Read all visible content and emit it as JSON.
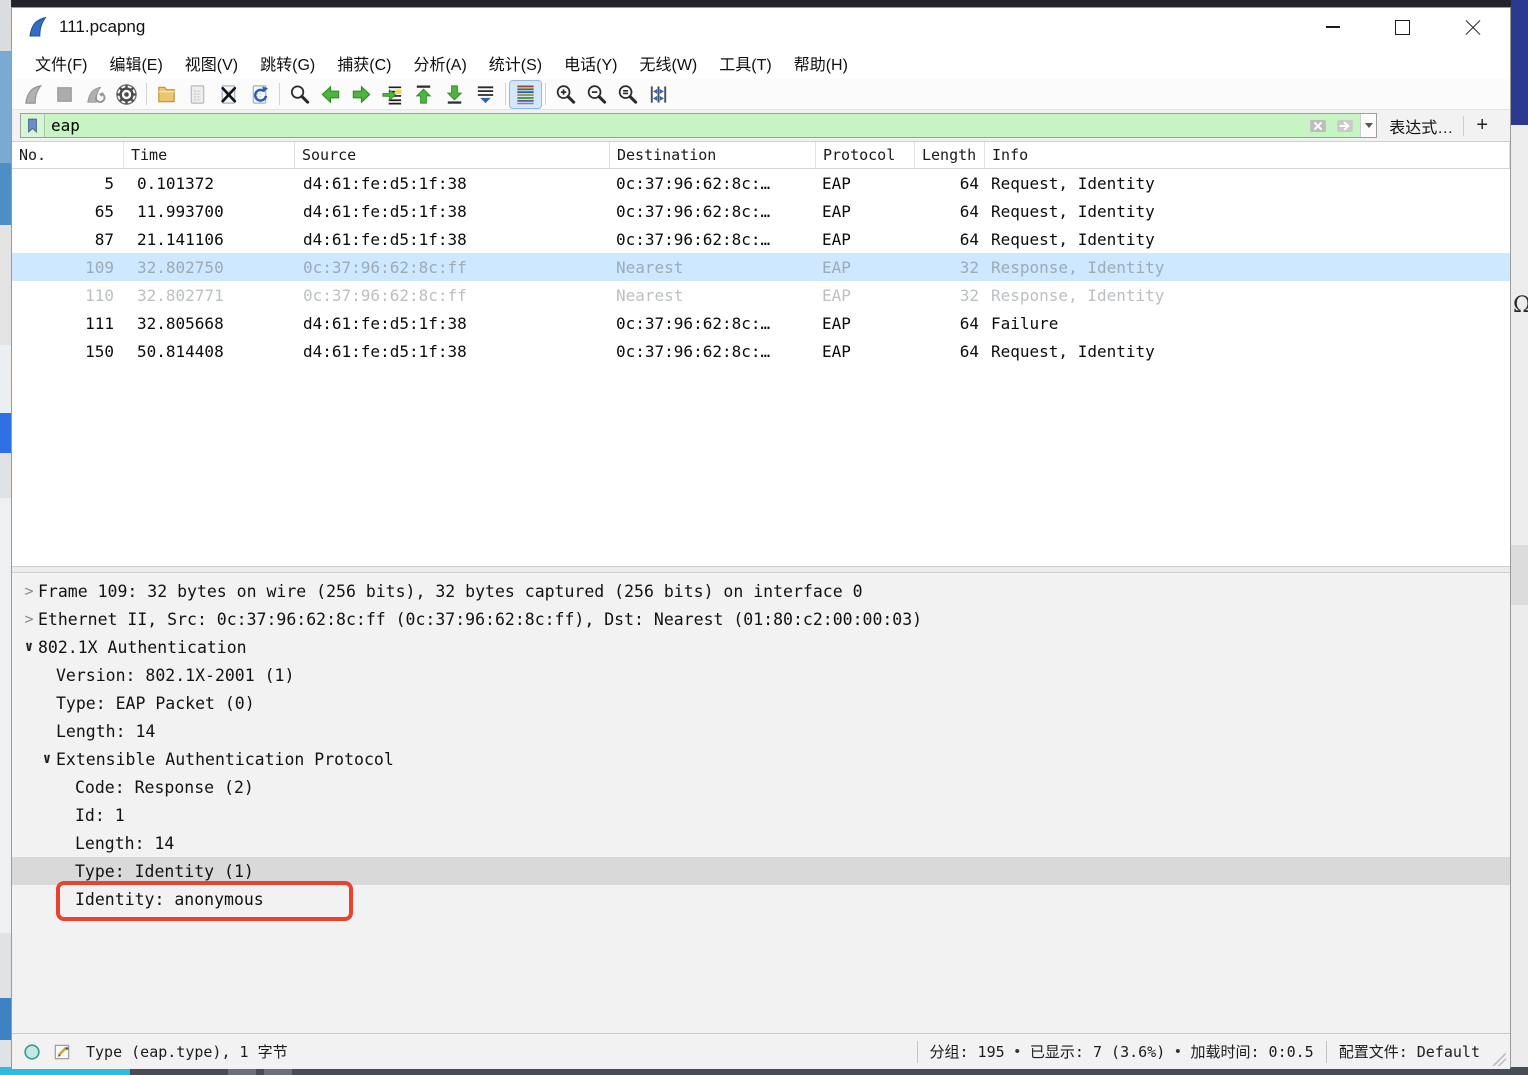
{
  "window": {
    "title": "111.pcapng",
    "controls": {
      "minimize": "minimize-icon",
      "maximize": "maximize-icon",
      "close": "close-icon"
    }
  },
  "menu": {
    "items": [
      {
        "label": "文件(F)"
      },
      {
        "label": "编辑(E)"
      },
      {
        "label": "视图(V)"
      },
      {
        "label": "跳转(G)"
      },
      {
        "label": "捕获(C)"
      },
      {
        "label": "分析(A)"
      },
      {
        "label": "统计(S)"
      },
      {
        "label": "电话(Y)"
      },
      {
        "label": "无线(W)"
      },
      {
        "label": "工具(T)"
      },
      {
        "label": "帮助(H)"
      }
    ]
  },
  "toolbar": {
    "items": [
      {
        "type": "btn",
        "name": "start-capture-button",
        "icon": "shark-fin-icon",
        "state": "disabled"
      },
      {
        "type": "btn",
        "name": "stop-capture-button",
        "icon": "stop-icon",
        "state": "disabled"
      },
      {
        "type": "btn",
        "name": "restart-capture-button",
        "icon": "restart-capture-icon",
        "state": "disabled"
      },
      {
        "type": "btn",
        "name": "capture-options-button",
        "icon": "gear-icon",
        "state": ""
      },
      {
        "type": "sep",
        "name": "toolbar-separator",
        "icon": "shark-fin-icon",
        "state": ""
      },
      {
        "type": "btn",
        "name": "open-file-button",
        "icon": "folder-open-icon",
        "state": ""
      },
      {
        "type": "btn",
        "name": "save-file-button",
        "icon": "save-file-icon",
        "state": "disabled"
      },
      {
        "type": "btn",
        "name": "close-file-button",
        "icon": "close-file-icon",
        "state": ""
      },
      {
        "type": "btn",
        "name": "reload-file-button",
        "icon": "reload-file-icon",
        "state": ""
      },
      {
        "type": "sep",
        "name": "toolbar-separator",
        "icon": "shark-fin-icon",
        "state": ""
      },
      {
        "type": "btn",
        "name": "find-packet-button",
        "icon": "magnifier-icon",
        "state": ""
      },
      {
        "type": "btn",
        "name": "go-back-button",
        "icon": "arrow-left-icon",
        "state": ""
      },
      {
        "type": "btn",
        "name": "go-forward-button",
        "icon": "arrow-right-icon",
        "state": ""
      },
      {
        "type": "btn",
        "name": "goto-packet-button",
        "icon": "goto-packet-icon",
        "state": ""
      },
      {
        "type": "btn",
        "name": "go-first-packet-button",
        "icon": "go-top-icon",
        "state": ""
      },
      {
        "type": "btn",
        "name": "go-last-packet-button",
        "icon": "go-bottom-icon",
        "state": ""
      },
      {
        "type": "btn",
        "name": "autoscroll-button",
        "icon": "autoscroll-icon",
        "state": ""
      },
      {
        "type": "sep",
        "name": "toolbar-separator",
        "icon": "shark-fin-icon",
        "state": ""
      },
      {
        "type": "btn",
        "name": "colorize-button",
        "icon": "colorize-icon",
        "state": "active"
      },
      {
        "type": "sep",
        "name": "toolbar-separator",
        "icon": "shark-fin-icon",
        "state": ""
      },
      {
        "type": "btn",
        "name": "zoom-in-button",
        "icon": "zoom-in-icon",
        "state": ""
      },
      {
        "type": "btn",
        "name": "zoom-out-button",
        "icon": "zoom-out-icon",
        "state": ""
      },
      {
        "type": "btn",
        "name": "zoom-reset-button",
        "icon": "zoom-reset-icon",
        "state": ""
      },
      {
        "type": "btn",
        "name": "resize-columns-button",
        "icon": "resize-columns-icon",
        "state": ""
      }
    ]
  },
  "filter": {
    "value": "eap",
    "bookmark_icon": "bookmark-icon",
    "clear_icon": "clear-x-icon",
    "apply_icon": "apply-arrow-icon",
    "dropdown_icon": "chevron-down-icon",
    "expression_label": "表达式…",
    "add_label": "+"
  },
  "packet_list": {
    "columns": [
      {
        "label": "No."
      },
      {
        "label": "Time"
      },
      {
        "label": "Source"
      },
      {
        "label": "Destination"
      },
      {
        "label": "Protocol"
      },
      {
        "label": "Length"
      },
      {
        "label": "Info"
      }
    ],
    "rows": [
      {
        "no": "5",
        "time": "0.101372",
        "source": "d4:61:fe:d5:1f:38",
        "destination": "0c:37:96:62:8c:…",
        "protocol": "EAP",
        "length": "64",
        "info": "Request, Identity",
        "state": ""
      },
      {
        "no": "65",
        "time": "11.993700",
        "source": "d4:61:fe:d5:1f:38",
        "destination": "0c:37:96:62:8c:…",
        "protocol": "EAP",
        "length": "64",
        "info": "Request, Identity",
        "state": ""
      },
      {
        "no": "87",
        "time": "21.141106",
        "source": "d4:61:fe:d5:1f:38",
        "destination": "0c:37:96:62:8c:…",
        "protocol": "EAP",
        "length": "64",
        "info": "Request, Identity",
        "state": ""
      },
      {
        "no": "109",
        "time": "32.802750",
        "source": "0c:37:96:62:8c:ff",
        "destination": "Nearest",
        "protocol": "EAP",
        "length": "32",
        "info": "Response, Identity",
        "state": "selected"
      },
      {
        "no": "110",
        "time": "32.802771",
        "source": "0c:37:96:62:8c:ff",
        "destination": "Nearest",
        "protocol": "EAP",
        "length": "32",
        "info": "Response, Identity",
        "state": "dimmed"
      },
      {
        "no": "111",
        "time": "32.805668",
        "source": "d4:61:fe:d5:1f:38",
        "destination": "0c:37:96:62:8c:…",
        "protocol": "EAP",
        "length": "64",
        "info": "Failure",
        "state": ""
      },
      {
        "no": "150",
        "time": "50.814408",
        "source": "d4:61:fe:d5:1f:38",
        "destination": "0c:37:96:62:8c:…",
        "protocol": "EAP",
        "length": "64",
        "info": "Request, Identity",
        "state": ""
      }
    ]
  },
  "details": {
    "lines": [
      {
        "expander": "chevron-right-icon",
        "indent": 0,
        "state": "",
        "text": "Frame 109: 32 bytes on wire (256 bits), 32 bytes captured (256 bits) on interface 0"
      },
      {
        "expander": "chevron-right-icon",
        "indent": 0,
        "state": "",
        "text": "Ethernet II, Src: 0c:37:96:62:8c:ff (0c:37:96:62:8c:ff), Dst: Nearest (01:80:c2:00:00:03)"
      },
      {
        "expander": "chevron-down-icon",
        "indent": 0,
        "state": "",
        "text": "802.1X Authentication"
      },
      {
        "expander": "none",
        "indent": 1,
        "state": "",
        "text": "Version: 802.1X-2001 (1)"
      },
      {
        "expander": "none",
        "indent": 1,
        "state": "",
        "text": "Type: EAP Packet (0)"
      },
      {
        "expander": "none",
        "indent": 1,
        "state": "",
        "text": "Length: 14"
      },
      {
        "expander": "chevron-down-icon",
        "indent": 1,
        "state": "",
        "text": "Extensible Authentication Protocol"
      },
      {
        "expander": "none",
        "indent": 2,
        "state": "",
        "text": "Code: Response (2)"
      },
      {
        "expander": "none",
        "indent": 2,
        "state": "",
        "text": "Id: 1"
      },
      {
        "expander": "none",
        "indent": 2,
        "state": "",
        "text": "Length: 14"
      },
      {
        "expander": "none",
        "indent": 2,
        "state": "field-selected",
        "text": "Type: Identity (1)"
      },
      {
        "expander": "none",
        "indent": 2,
        "state": "annotated",
        "text": "Identity: anonymous"
      }
    ]
  },
  "status_bar": {
    "capture_icon": "capture-info-icon",
    "annotation_icon": "annotation-icon",
    "left_text": "Type (eap.type), 1 字节",
    "packets": "分组: 195",
    "bullet": "•",
    "displayed": "已显示: 7 (3.6%)",
    "load_time": "加载时间: 0:0.5",
    "profile": "配置文件: Default"
  },
  "background": {
    "right_edge_glyph": "Ω"
  },
  "colors": {
    "filter_valid_bg": "#c8f3c3",
    "selected_row_bg": "#cde8ff",
    "annotation_red": "#e8432f",
    "field_selected_bg": "#d9d9d9",
    "toolbar_active_bg": "#d5e8fa"
  }
}
